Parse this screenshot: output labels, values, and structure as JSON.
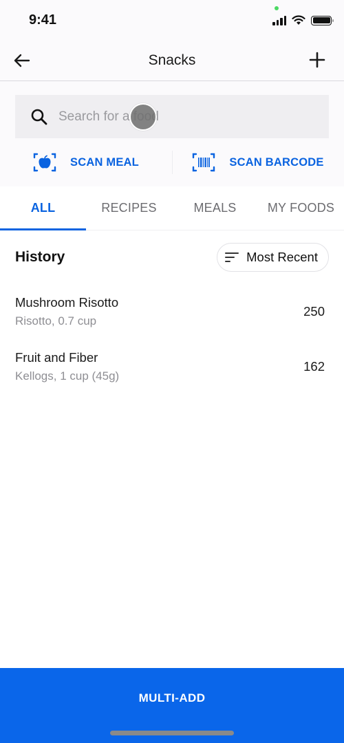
{
  "status_bar": {
    "time": "9:41",
    "signal_bars": 4,
    "wifi": true,
    "battery_percent": 100
  },
  "nav": {
    "title": "Snacks",
    "back_icon": "arrow-left-icon",
    "add_icon": "plus-icon"
  },
  "search": {
    "placeholder": "Search for a food",
    "value": "",
    "icon": "search-icon"
  },
  "scan": {
    "meal_label": "SCAN MEAL",
    "meal_icon": "apple-scan-icon",
    "barcode_label": "SCAN BARCODE",
    "barcode_icon": "barcode-scan-icon"
  },
  "tabs": [
    {
      "label": "ALL",
      "active": true
    },
    {
      "label": "RECIPES",
      "active": false
    },
    {
      "label": "MEALS",
      "active": false
    },
    {
      "label": "MY FOODS",
      "active": false
    }
  ],
  "history": {
    "title": "History",
    "sort_label": "Most Recent",
    "sort_icon": "sort-lines-icon",
    "items": [
      {
        "name": "Mushroom Risotto",
        "description": "Risotto, 0.7 cup",
        "calories": "250"
      },
      {
        "name": "Fruit and Fiber",
        "description": "Kellogs, 1 cup (45g)",
        "calories": "162"
      }
    ]
  },
  "footer": {
    "multi_add_label": "MULTI-ADD"
  },
  "colors": {
    "accent": "#0a63e0",
    "footer_bg": "#0a66ea",
    "search_bg": "#efeef1",
    "muted_text": "#8e8e93"
  }
}
